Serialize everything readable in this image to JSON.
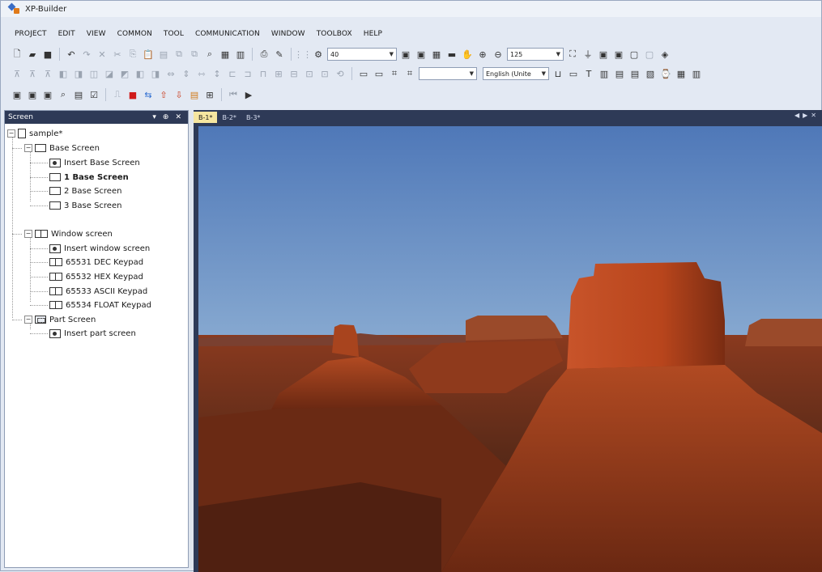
{
  "window": {
    "title": "XP-Builder"
  },
  "menu": [
    "PROJECT",
    "EDIT",
    "VIEW",
    "COMMON",
    "TOOL",
    "COMMUNICATION",
    "WINDOW",
    "TOOLBOX",
    "HELP"
  ],
  "toolbar": {
    "grid_value": "40",
    "zoom_value": "125",
    "language": "English (Unite",
    "object_combo_value": ""
  },
  "panel": {
    "title": "Screen"
  },
  "tree": {
    "root": "sample*",
    "base_group": "Base Screen",
    "insert_base": "Insert Base Screen",
    "base_1": "1 Base Screen",
    "base_2": "2 Base Screen",
    "base_3": "3 Base Screen",
    "window_group": "Window screen",
    "insert_window": "Insert window screen",
    "win_1": "65531 DEC Keypad",
    "win_2": "65532 HEX Keypad",
    "win_3": "65533 ASCII Keypad",
    "win_4": "65534 FLOAT Keypad",
    "part_group": "Part Screen",
    "insert_part": "Insert part screen"
  },
  "tabs": [
    "B-1*",
    "B-2*",
    "B-3*"
  ],
  "colors": {
    "panel_header": "#2e3a57",
    "active_tab": "#f6e6a0",
    "sky_top": "#4f78b8",
    "rock": "#b8451c"
  }
}
